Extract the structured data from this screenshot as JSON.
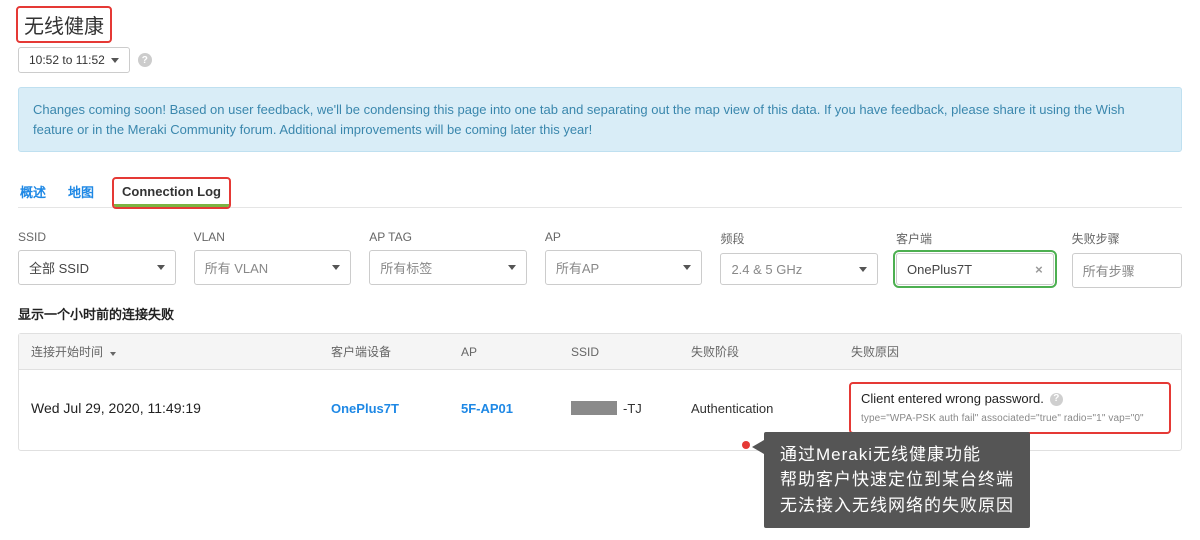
{
  "page": {
    "title": "无线健康"
  },
  "time_selector": {
    "label": "10:52 to 11:52"
  },
  "notice": "Changes coming soon! Based on user feedback, we'll be condensing this page into one tab and separating out the map view of this data. If you have feedback, please share it using the Wish feature or in the Meraki Community forum. Additional improvements will be coming later this year!",
  "tabs": {
    "overview": "概述",
    "map": "地图",
    "connection_log": "Connection Log"
  },
  "filters": {
    "ssid": {
      "label": "SSID",
      "value": "全部 SSID"
    },
    "vlan": {
      "label": "VLAN",
      "value": "所有 VLAN"
    },
    "ap_tag": {
      "label": "AP TAG",
      "value": "所有标签"
    },
    "ap": {
      "label": "AP",
      "value": "所有AP"
    },
    "band": {
      "label": "频段",
      "value": "2.4 & 5 GHz"
    },
    "client": {
      "label": "客户端",
      "value": "OnePlus7T"
    },
    "step": {
      "label": "失败步骤",
      "value": "所有步骤"
    }
  },
  "summary": "显示一个小时前的连接失败",
  "table": {
    "headers": {
      "time": "连接开始时间",
      "client": "客户端设备",
      "ap": "AP",
      "ssid": "SSID",
      "stage": "失败阶段",
      "reason": "失败原因"
    },
    "row": {
      "time": "Wed Jul 29, 2020, 11:49:19",
      "client": "OnePlus7T",
      "ap": "5F-AP01",
      "ssid_suffix": "-TJ",
      "stage": "Authentication",
      "reason_title": "Client entered wrong password.",
      "reason_detail": "type=\"WPA-PSK auth fail\" associated=\"true\" radio=\"1\" vap=\"0\""
    }
  },
  "annotation": "通过Meraki无线健康功能\n帮助客户快速定位到某台终端\n无法接入无线网络的失败原因"
}
